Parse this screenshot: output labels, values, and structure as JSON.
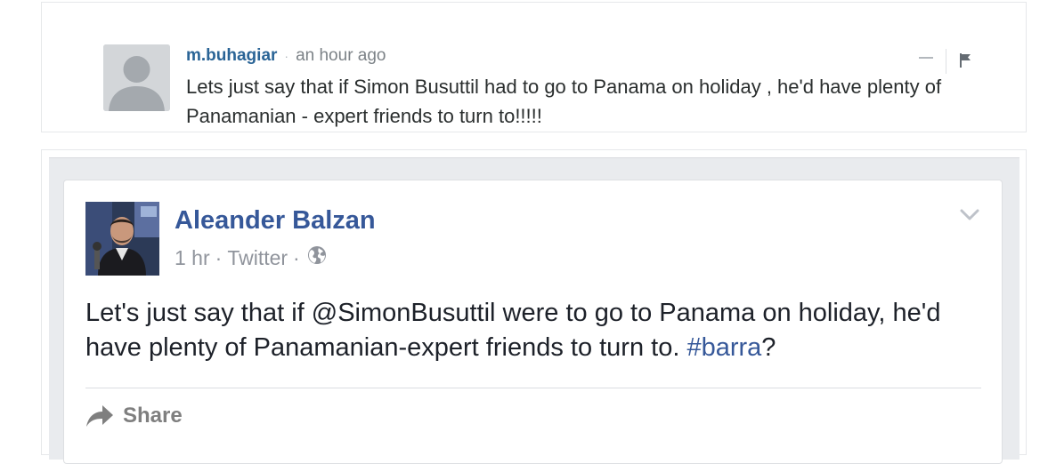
{
  "comment": {
    "author": "m.buhagiar",
    "separator": "·",
    "time": "an hour ago",
    "body": "Lets just say that if Simon Busuttil had to go to Panama on holiday , he'd have plenty of Panamanian - expert friends to turn to!!!!!",
    "icons": {
      "avatar": "default-user-avatar",
      "collapse": "minus-icon",
      "flag": "flag-icon"
    }
  },
  "post": {
    "author": "Aleander Balzan",
    "time": "1 hr",
    "meta_sep": "·",
    "source": "Twitter",
    "text_before": "Let's just say that if @SimonBusuttil were to go to Panama on holiday, he'd have plenty of Panamanian-expert friends to turn to. ",
    "hashtag": "#barra",
    "text_after": "?",
    "share_label": "Share",
    "icons": {
      "privacy": "globe-icon",
      "menu": "chevron-down-icon",
      "share": "share-arrow-icon"
    }
  },
  "colors": {
    "comment_author": "#2a6496",
    "fb_blue": "#365899",
    "fb_gray": "#90949c",
    "embed_bg": "#e9ebee"
  }
}
